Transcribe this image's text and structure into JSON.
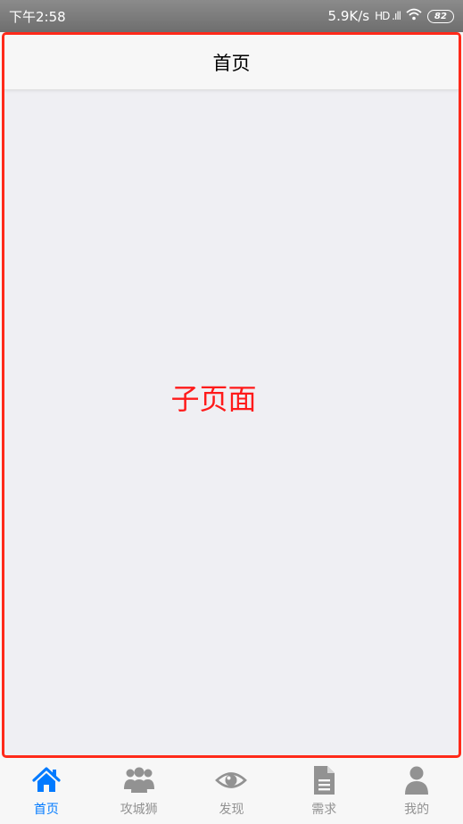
{
  "status_bar": {
    "time": "下午2:58",
    "speed": "5.9K/s",
    "signal": "HD .ıll",
    "wifi": "wifi-icon",
    "battery": "82"
  },
  "nav": {
    "title": "首页"
  },
  "content": {
    "label": "子页面"
  },
  "tabs": [
    {
      "label": "首页",
      "icon": "home-icon",
      "active": true
    },
    {
      "label": "攻城狮",
      "icon": "users-icon",
      "active": false
    },
    {
      "label": "发现",
      "icon": "eye-icon",
      "active": false
    },
    {
      "label": "需求",
      "icon": "document-icon",
      "active": false
    },
    {
      "label": "我的",
      "icon": "user-icon",
      "active": false
    }
  ],
  "colors": {
    "active": "#007aff",
    "inactive": "#929292",
    "frame_border": "#ff2a1a",
    "content_label": "#ff1a1a"
  }
}
